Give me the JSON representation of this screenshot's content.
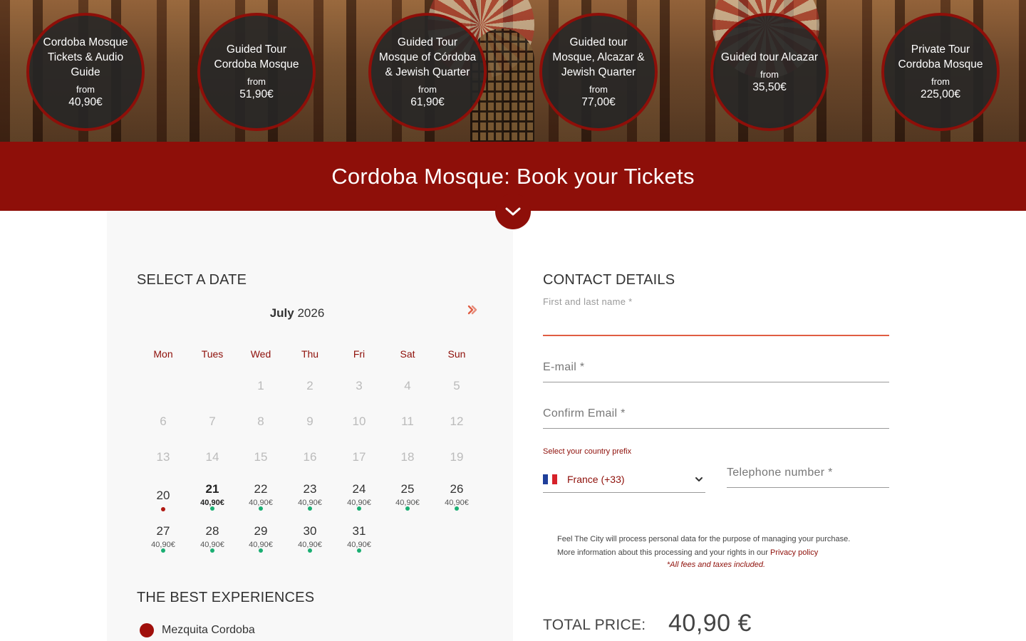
{
  "tours": [
    {
      "name": "Cordoba Mosque Tickets & Audio Guide",
      "from": "from",
      "price": "40,90€"
    },
    {
      "name": "Guided Tour Cordoba Mosque",
      "from": "from",
      "price": "51,90€"
    },
    {
      "name": "Guided Tour Mosque of Córdoba & Jewish Quarter",
      "from": "from",
      "price": "61,90€"
    },
    {
      "name": "Guided tour Mosque, Alcazar & Jewish Quarter",
      "from": "from",
      "price": "77,00€"
    },
    {
      "name": "Guided tour Alcazar",
      "from": "from",
      "price": "35,50€"
    },
    {
      "name": "Private Tour Cordoba Mosque",
      "from": "from",
      "price": "225,00€"
    }
  ],
  "banner": {
    "title": "Cordoba Mosque: Book your Tickets"
  },
  "calendar": {
    "section_title": "SELECT A DATE",
    "month": "July",
    "year": "2026",
    "weekdays": [
      "Mon",
      "Tues",
      "Wed",
      "Thu",
      "Fri",
      "Sat",
      "Sun"
    ],
    "rows": [
      [
        {
          "n": ""
        },
        {
          "n": ""
        },
        {
          "n": "1"
        },
        {
          "n": "2"
        },
        {
          "n": "3"
        },
        {
          "n": "4"
        },
        {
          "n": "5"
        }
      ],
      [
        {
          "n": "6"
        },
        {
          "n": "7"
        },
        {
          "n": "8"
        },
        {
          "n": "9"
        },
        {
          "n": "10"
        },
        {
          "n": "11"
        },
        {
          "n": "12"
        }
      ],
      [
        {
          "n": "13"
        },
        {
          "n": "14"
        },
        {
          "n": "15"
        },
        {
          "n": "16"
        },
        {
          "n": "17"
        },
        {
          "n": "18"
        },
        {
          "n": "19"
        }
      ],
      [
        {
          "n": "20",
          "state": "today"
        },
        {
          "n": "21",
          "price": "40,90€",
          "state": "selected"
        },
        {
          "n": "22",
          "price": "40,90€"
        },
        {
          "n": "23",
          "price": "40,90€"
        },
        {
          "n": "24",
          "price": "40,90€"
        },
        {
          "n": "25",
          "price": "40,90€"
        },
        {
          "n": "26",
          "price": "40,90€"
        }
      ],
      [
        {
          "n": "27",
          "price": "40,90€"
        },
        {
          "n": "28",
          "price": "40,90€"
        },
        {
          "n": "29",
          "price": "40,90€"
        },
        {
          "n": "30",
          "price": "40,90€"
        },
        {
          "n": "31",
          "price": "40,90€"
        },
        {
          "n": ""
        },
        {
          "n": ""
        }
      ]
    ]
  },
  "experiences": {
    "section_title": "THE BEST EXPERIENCES",
    "items": [
      {
        "label": "Mezquita Cordoba"
      }
    ]
  },
  "contact": {
    "section_title": "CONTACT DETAILS",
    "name_label": "First and last name *",
    "email_label": "E-mail *",
    "confirm_email_label": "Confirm Email *",
    "prefix_label": "Select your country prefix",
    "prefix_value": "France (+33)",
    "telephone_label": "Telephone number *",
    "privacy_line1": "Feel The City will process personal data for the purpose of managing your purchase.",
    "privacy_line2": "More information about this processing and your rights in our",
    "privacy_link": "Privacy policy",
    "fees_note": "*All fees and taxes included."
  },
  "total": {
    "label": "TOTAL PRICE:",
    "value": "40,90 €"
  },
  "colors": {
    "brand": "#8e0f09",
    "available_dot": "#1bae72",
    "today_dot": "#b01812",
    "focus_underline": "#e05d43"
  }
}
